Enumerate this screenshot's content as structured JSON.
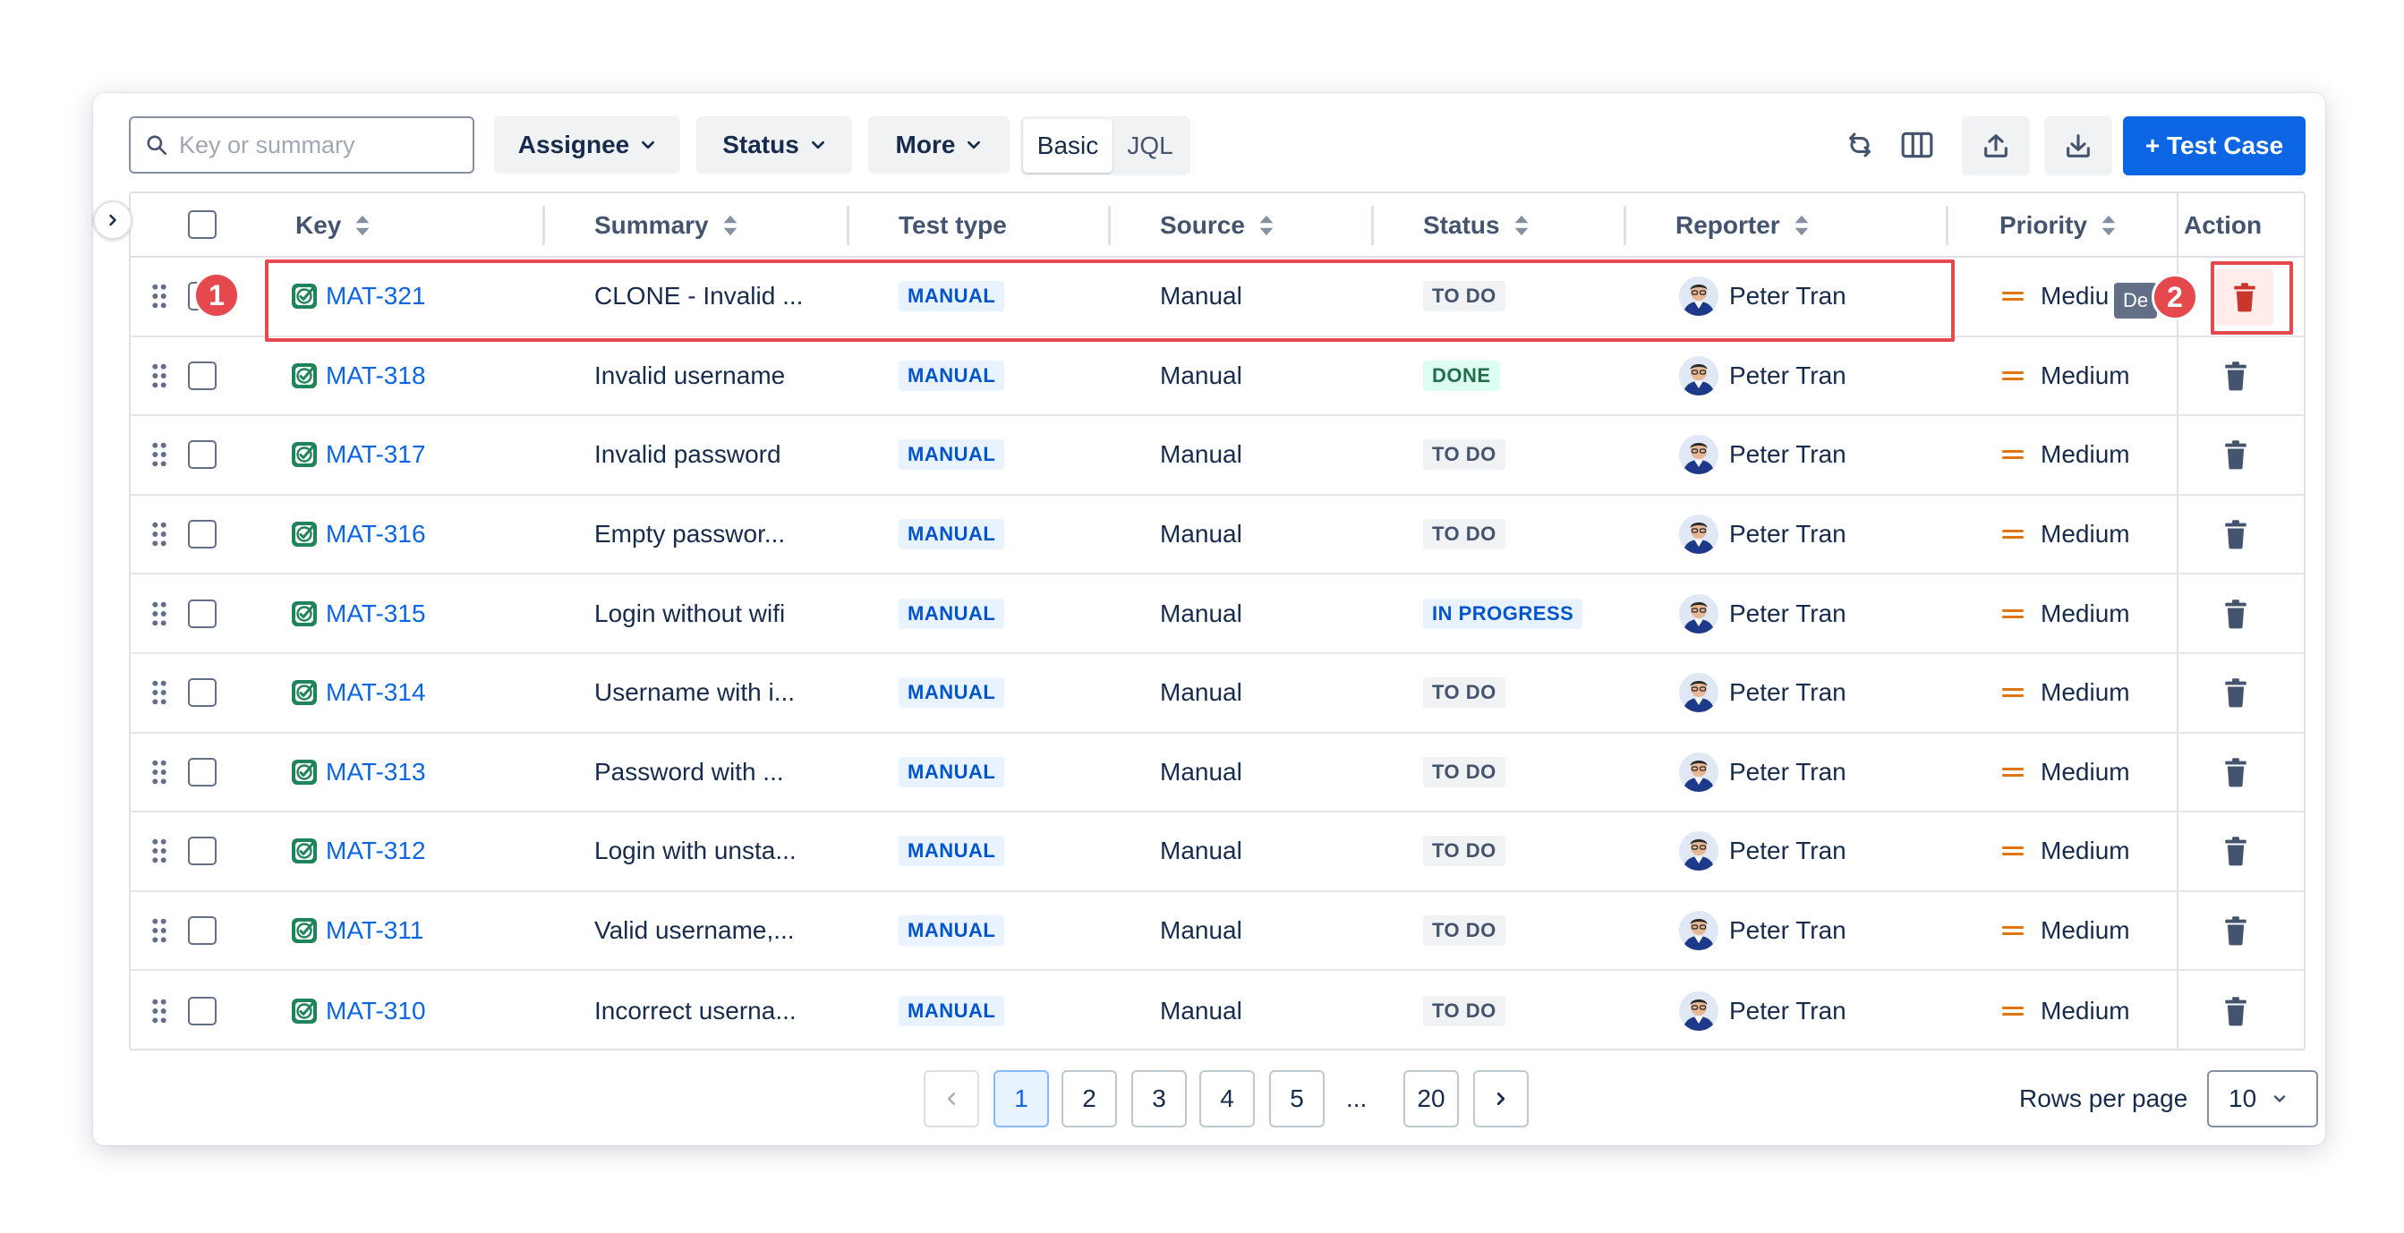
{
  "toolbar": {
    "search_placeholder": "Key or summary",
    "filters": [
      "Assignee",
      "Status",
      "More"
    ],
    "modes": [
      "Basic",
      "JQL"
    ],
    "active_mode": "Basic",
    "icons": [
      "refresh-icon",
      "columns-icon",
      "export-icon",
      "import-icon"
    ],
    "create_label": "+ Test Case"
  },
  "table": {
    "columns": {
      "key": "Key",
      "summary": "Summary",
      "test_type": "Test type",
      "source": "Source",
      "status": "Status",
      "reporter": "Reporter",
      "priority": "Priority",
      "action": "Action"
    },
    "rows": [
      {
        "key": "MAT-321",
        "summary": "CLONE - Invalid ...",
        "test_type": "MANUAL",
        "source": "Manual",
        "status": "TO DO",
        "reporter": "Peter Tran",
        "priority": "Mediu"
      },
      {
        "key": "MAT-318",
        "summary": "Invalid username",
        "test_type": "MANUAL",
        "source": "Manual",
        "status": "DONE",
        "reporter": "Peter Tran",
        "priority": "Medium"
      },
      {
        "key": "MAT-317",
        "summary": "Invalid password",
        "test_type": "MANUAL",
        "source": "Manual",
        "status": "TO DO",
        "reporter": "Peter Tran",
        "priority": "Medium"
      },
      {
        "key": "MAT-316",
        "summary": "Empty passwor...",
        "test_type": "MANUAL",
        "source": "Manual",
        "status": "TO DO",
        "reporter": "Peter Tran",
        "priority": "Medium"
      },
      {
        "key": "MAT-315",
        "summary": "Login without wifi",
        "test_type": "MANUAL",
        "source": "Manual",
        "status": "IN PROGRESS",
        "reporter": "Peter Tran",
        "priority": "Medium"
      },
      {
        "key": "MAT-314",
        "summary": "Username with i...",
        "test_type": "MANUAL",
        "source": "Manual",
        "status": "TO DO",
        "reporter": "Peter Tran",
        "priority": "Medium"
      },
      {
        "key": "MAT-313",
        "summary": "Password with ...",
        "test_type": "MANUAL",
        "source": "Manual",
        "status": "TO DO",
        "reporter": "Peter Tran",
        "priority": "Medium"
      },
      {
        "key": "MAT-312",
        "summary": "Login with unsta...",
        "test_type": "MANUAL",
        "source": "Manual",
        "status": "TO DO",
        "reporter": "Peter Tran",
        "priority": "Medium"
      },
      {
        "key": "MAT-311",
        "summary": "Valid username,...",
        "test_type": "MANUAL",
        "source": "Manual",
        "status": "TO DO",
        "reporter": "Peter Tran",
        "priority": "Medium"
      },
      {
        "key": "MAT-310",
        "summary": "Incorrect userna...",
        "test_type": "MANUAL",
        "source": "Manual",
        "status": "TO DO",
        "reporter": "Peter Tran",
        "priority": "Medium"
      }
    ],
    "tooltip_text": "De"
  },
  "annotations": {
    "badge_1": "1",
    "badge_2": "2",
    "color": "#e5484d"
  },
  "pagination": {
    "pages": [
      "1",
      "2",
      "3",
      "4",
      "5"
    ],
    "ellipsis": "...",
    "last_page": "20",
    "current_page": "1",
    "rows_per_page_label": "Rows per page",
    "rows_per_page_value": "10"
  },
  "colors": {
    "primary": "#0c66e4",
    "priority_medium": "#e2740d",
    "status_done_bg": "#dcfff1",
    "status_progress_bg": "#e9f2ff"
  }
}
